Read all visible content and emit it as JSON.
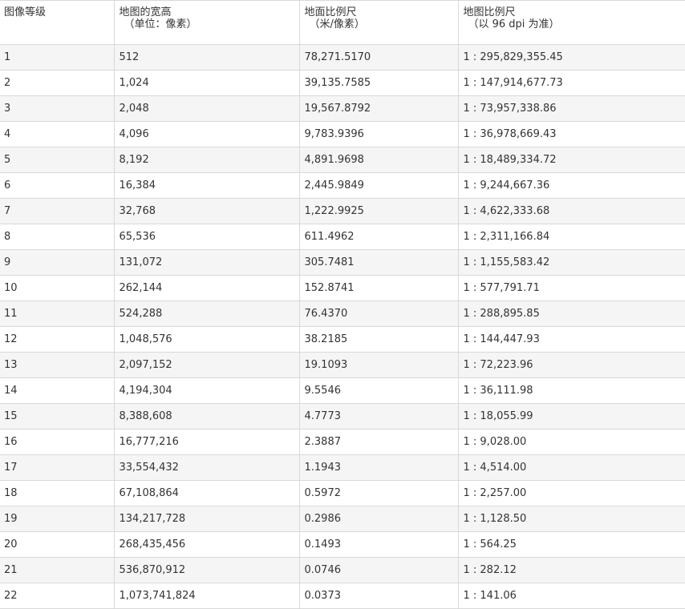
{
  "table": {
    "headers": [
      {
        "line1": "图像等级",
        "line2": ""
      },
      {
        "line1": "地图的宽高",
        "line2": "（单位：像素）"
      },
      {
        "line1": "地面比例尺",
        "line2": "（米/像素）"
      },
      {
        "line1": "地图比例尺",
        "line2": "（以 96 dpi 为准）"
      }
    ],
    "rows": [
      [
        "1",
        "512",
        "78,271.5170",
        "1 : 295,829,355.45"
      ],
      [
        "2",
        "1,024",
        "39,135.7585",
        "1 : 147,914,677.73"
      ],
      [
        "3",
        "2,048",
        "19,567.8792",
        "1 : 73,957,338.86"
      ],
      [
        "4",
        "4,096",
        "9,783.9396",
        "1 : 36,978,669.43"
      ],
      [
        "5",
        "8,192",
        "4,891.9698",
        "1 : 18,489,334.72"
      ],
      [
        "6",
        "16,384",
        "2,445.9849",
        "1 : 9,244,667.36"
      ],
      [
        "7",
        "32,768",
        "1,222.9925",
        "1 : 4,622,333.68"
      ],
      [
        "8",
        "65,536",
        "611.4962",
        "1 : 2,311,166.84"
      ],
      [
        "9",
        "131,072",
        "305.7481",
        "1 : 1,155,583.42"
      ],
      [
        "10",
        "262,144",
        "152.8741",
        "1 : 577,791.71"
      ],
      [
        "11",
        "524,288",
        "76.4370",
        "1 : 288,895.85"
      ],
      [
        "12",
        "1,048,576",
        "38.2185",
        "1 : 144,447.93"
      ],
      [
        "13",
        "2,097,152",
        "19.1093",
        "1 : 72,223.96"
      ],
      [
        "14",
        "4,194,304",
        "9.5546",
        "1 : 36,111.98"
      ],
      [
        "15",
        "8,388,608",
        "4.7773",
        "1 : 18,055.99"
      ],
      [
        "16",
        "16,777,216",
        "2.3887",
        "1 : 9,028.00"
      ],
      [
        "17",
        "33,554,432",
        "1.1943",
        "1 : 4,514.00"
      ],
      [
        "18",
        "67,108,864",
        "0.5972",
        "1 : 2,257.00"
      ],
      [
        "19",
        "134,217,728",
        "0.2986",
        "1 : 1,128.50"
      ],
      [
        "20",
        "268,435,456",
        "0.1493",
        "1 : 564.25"
      ],
      [
        "21",
        "536,870,912",
        "0.0746",
        "1 : 282.12"
      ],
      [
        "22",
        "1,073,741,824",
        "0.0373",
        "1 : 141.06"
      ]
    ]
  }
}
